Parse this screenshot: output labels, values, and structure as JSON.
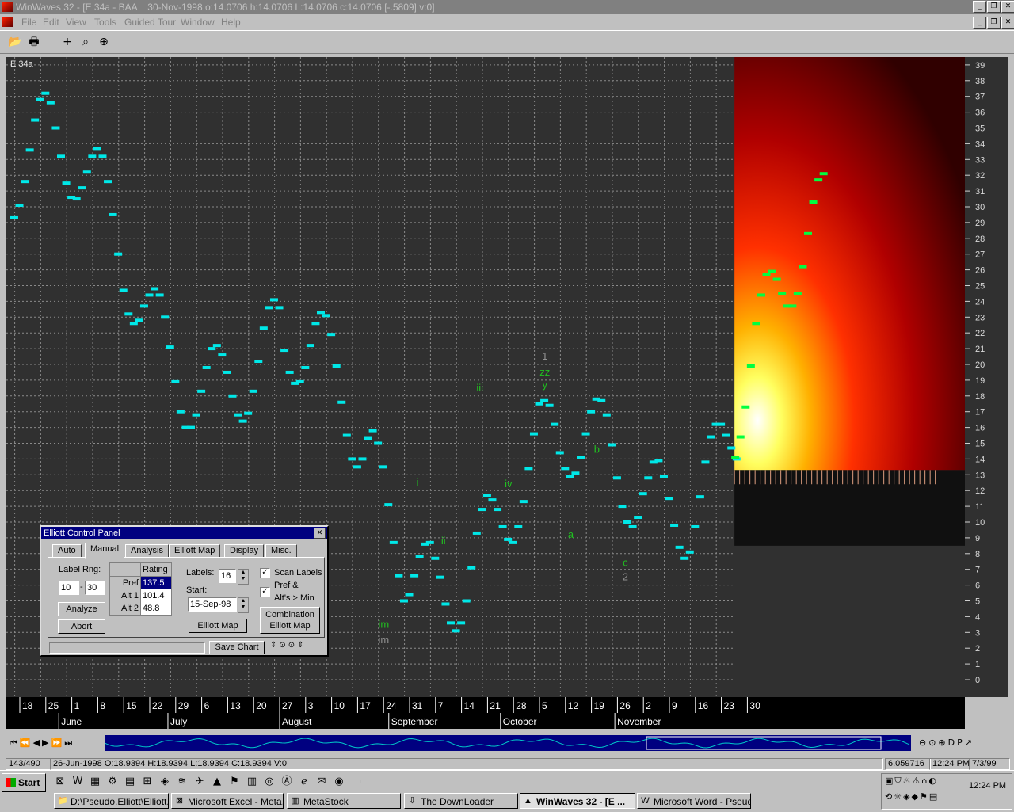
{
  "window": {
    "title": "WinWaves 32 - [E 34a - BAA    30-Nov-1998 o:14.0706 h:14.0706 L:14.0706 c:14.0706 [-.5809] v:0]"
  },
  "menu": [
    "File",
    "Edit",
    "View",
    "Tools",
    "Guided Tour",
    "Window",
    "Help"
  ],
  "toolbar_icons": [
    "open-icon",
    "print-icon",
    "crosshair-icon",
    "zoom-icon",
    "target-icon"
  ],
  "chart": {
    "symbol": "E 34a",
    "y_ticks": [
      "0",
      "1",
      "2",
      "3",
      "4",
      "5",
      "6",
      "7",
      "8",
      "9",
      "10",
      "11",
      "12",
      "13",
      "14",
      "15",
      "16",
      "17",
      "18",
      "19",
      "20",
      "21",
      "22",
      "23",
      "24",
      "25",
      "26",
      "27",
      "28",
      "29",
      "30",
      "31",
      "32",
      "33",
      "34",
      "35",
      "36",
      "37",
      "38",
      "39"
    ],
    "day_labels": [
      "18",
      "25",
      "1",
      "8",
      "15",
      "22",
      "29",
      "6",
      "13",
      "20",
      "27",
      "3",
      "10",
      "17",
      "24",
      "31",
      "7",
      "14",
      "21",
      "28",
      "5",
      "12",
      "19",
      "26",
      "2",
      "9",
      "16",
      "23",
      "30"
    ],
    "month_labels": [
      "June",
      "July",
      "August",
      "September",
      "October",
      "November"
    ],
    "wave_labels": [
      {
        "text": "1",
        "color": "#909090",
        "x": 19.9,
        "y": 20.3
      },
      {
        "text": "zz",
        "color": "#20c020",
        "x": 19.9,
        "y": 19.3
      },
      {
        "text": "y",
        "color": "#20c020",
        "x": 19.9,
        "y": 18.5
      },
      {
        "text": "iii",
        "color": "#20c020",
        "x": 17.4,
        "y": 18.3
      },
      {
        "text": "iv",
        "color": "#20c020",
        "x": 18.5,
        "y": 12.2
      },
      {
        "text": "i",
        "color": "#20c020",
        "x": 15.0,
        "y": 12.3
      },
      {
        "text": "ii",
        "color": "#20c020",
        "x": 16.0,
        "y": 8.6
      },
      {
        "text": "b",
        "color": "#20c020",
        "x": 21.9,
        "y": 14.4
      },
      {
        "text": "a",
        "color": "#20c020",
        "x": 20.9,
        "y": 9.0
      },
      {
        "text": "c",
        "color": "#20c020",
        "x": 23.0,
        "y": 7.2
      },
      {
        "text": "2",
        "color": "#909090",
        "x": 23.0,
        "y": 6.3
      },
      {
        "text": "im",
        "color": "#20c020",
        "x": 13.7,
        "y": 3.3
      },
      {
        "text": "im",
        "color": "#909090",
        "x": 13.7,
        "y": 2.3
      }
    ],
    "nav_icons": [
      "first-icon",
      "rewind-icon",
      "prev-icon",
      "next-icon",
      "fast-forward-icon",
      "last-icon"
    ],
    "right_icons": [
      "zoom-out-icon",
      "zoom-reset-icon",
      "zoom-in-icon",
      "d-icon",
      "p-icon",
      "trend-icon"
    ]
  },
  "chart_data": {
    "type": "scatter",
    "x_unit": "week index (0 = 18-Jun-1998)",
    "series": [
      {
        "name": "price",
        "values": [
          [
            -0.55,
            29.3
          ],
          [
            -0.35,
            30.1
          ],
          [
            -0.15,
            31.6
          ],
          [
            0.05,
            33.6
          ],
          [
            0.25,
            35.5
          ],
          [
            0.45,
            36.8
          ],
          [
            0.65,
            37.2
          ],
          [
            0.85,
            36.6
          ],
          [
            1.05,
            35.0
          ],
          [
            1.25,
            33.2
          ],
          [
            1.45,
            31.5
          ],
          [
            1.65,
            30.6
          ],
          [
            1.85,
            30.5
          ],
          [
            2.05,
            31.2
          ],
          [
            2.25,
            32.2
          ],
          [
            2.45,
            33.2
          ],
          [
            2.65,
            33.7
          ],
          [
            2.85,
            33.2
          ],
          [
            3.05,
            31.6
          ],
          [
            3.25,
            29.5
          ],
          [
            3.45,
            27.0
          ],
          [
            3.65,
            24.7
          ],
          [
            3.85,
            23.2
          ],
          [
            4.05,
            22.6
          ],
          [
            4.25,
            22.8
          ],
          [
            4.45,
            23.7
          ],
          [
            4.65,
            24.4
          ],
          [
            4.85,
            24.8
          ],
          [
            5.05,
            24.4
          ],
          [
            5.25,
            23.0
          ],
          [
            5.45,
            21.1
          ],
          [
            5.65,
            18.9
          ],
          [
            5.85,
            17.0
          ],
          [
            6.05,
            16.0
          ],
          [
            6.25,
            16.0
          ],
          [
            6.45,
            16.8
          ],
          [
            6.65,
            18.3
          ],
          [
            6.85,
            19.8
          ],
          [
            7.05,
            21.0
          ],
          [
            7.25,
            21.2
          ],
          [
            7.45,
            20.6
          ],
          [
            7.65,
            19.5
          ],
          [
            7.85,
            18.0
          ],
          [
            8.05,
            16.8
          ],
          [
            8.25,
            16.4
          ],
          [
            8.45,
            16.9
          ],
          [
            8.65,
            18.3
          ],
          [
            8.85,
            20.2
          ],
          [
            9.05,
            22.3
          ],
          [
            9.25,
            23.6
          ],
          [
            9.45,
            24.1
          ],
          [
            9.65,
            23.6
          ],
          [
            9.85,
            20.9
          ],
          [
            10.05,
            19.5
          ],
          [
            10.25,
            18.8
          ],
          [
            10.45,
            18.9
          ],
          [
            10.65,
            19.8
          ],
          [
            10.85,
            21.2
          ],
          [
            11.05,
            22.6
          ],
          [
            11.25,
            23.3
          ],
          [
            11.45,
            23.1
          ],
          [
            11.65,
            21.9
          ],
          [
            11.85,
            19.9
          ],
          [
            12.05,
            17.6
          ],
          [
            12.25,
            15.5
          ],
          [
            12.45,
            14.0
          ],
          [
            12.65,
            13.5
          ],
          [
            12.85,
            14.0
          ],
          [
            13.05,
            15.3
          ],
          [
            13.25,
            15.8
          ],
          [
            13.45,
            15.0
          ],
          [
            13.65,
            13.5
          ],
          [
            13.85,
            11.1
          ],
          [
            14.05,
            8.7
          ],
          [
            14.25,
            6.6
          ],
          [
            14.45,
            5.0
          ],
          [
            14.65,
            5.4
          ],
          [
            14.85,
            6.6
          ],
          [
            15.05,
            7.8
          ],
          [
            15.25,
            8.6
          ],
          [
            15.45,
            8.7
          ],
          [
            15.65,
            7.7
          ],
          [
            15.85,
            6.5
          ],
          [
            16.05,
            4.8
          ],
          [
            16.25,
            3.6
          ],
          [
            16.45,
            3.1
          ],
          [
            16.65,
            3.6
          ],
          [
            16.85,
            5.0
          ],
          [
            17.05,
            7.1
          ],
          [
            17.25,
            9.3
          ],
          [
            17.45,
            10.8
          ],
          [
            17.65,
            11.7
          ],
          [
            17.85,
            11.4
          ],
          [
            18.05,
            10.8
          ],
          [
            18.25,
            9.7
          ],
          [
            18.45,
            8.9
          ],
          [
            18.65,
            8.7
          ],
          [
            18.85,
            9.7
          ],
          [
            19.05,
            11.3
          ],
          [
            19.25,
            13.4
          ],
          [
            19.45,
            15.6
          ],
          [
            19.65,
            17.5
          ],
          [
            19.85,
            17.7
          ],
          [
            20.05,
            17.4
          ],
          [
            20.25,
            16.2
          ],
          [
            20.45,
            14.4
          ],
          [
            20.65,
            13.4
          ],
          [
            20.85,
            12.9
          ],
          [
            21.05,
            13.1
          ],
          [
            21.25,
            14.1
          ],
          [
            21.45,
            15.6
          ],
          [
            21.65,
            17.0
          ],
          [
            21.85,
            17.8
          ],
          [
            22.05,
            17.7
          ],
          [
            22.25,
            16.8
          ],
          [
            22.45,
            14.9
          ],
          [
            22.65,
            12.8
          ],
          [
            22.85,
            11.0
          ],
          [
            23.05,
            10.0
          ],
          [
            23.25,
            9.7
          ],
          [
            23.45,
            10.3
          ],
          [
            23.65,
            11.8
          ],
          [
            23.85,
            12.8
          ],
          [
            24.05,
            13.8
          ],
          [
            24.25,
            13.9
          ],
          [
            24.45,
            12.9
          ],
          [
            24.65,
            11.5
          ],
          [
            24.85,
            9.8
          ],
          [
            25.05,
            8.4
          ],
          [
            25.25,
            7.7
          ],
          [
            25.45,
            8.1
          ],
          [
            25.65,
            9.7
          ],
          [
            25.85,
            11.6
          ],
          [
            26.05,
            13.8
          ],
          [
            26.25,
            15.4
          ],
          [
            26.45,
            16.2
          ],
          [
            26.65,
            16.2
          ],
          [
            26.85,
            15.5
          ],
          [
            27.05,
            14.7
          ],
          [
            27.25,
            14.0
          ]
        ]
      },
      {
        "name": "projection",
        "values": [
          [
            27.2,
            14.1
          ],
          [
            27.4,
            15.4
          ],
          [
            27.6,
            17.3
          ],
          [
            27.8,
            19.9
          ],
          [
            28.0,
            22.6
          ],
          [
            28.2,
            24.4
          ],
          [
            28.4,
            25.7
          ],
          [
            28.6,
            25.9
          ],
          [
            28.8,
            25.4
          ],
          [
            29.0,
            24.5
          ],
          [
            29.2,
            23.7
          ],
          [
            29.4,
            23.7
          ],
          [
            29.6,
            24.5
          ],
          [
            29.8,
            26.2
          ],
          [
            30.0,
            28.3
          ],
          [
            30.2,
            30.3
          ],
          [
            30.4,
            31.7
          ],
          [
            30.6,
            32.1
          ]
        ]
      }
    ],
    "ylim": [
      -1,
      39.6
    ],
    "xlim": [
      -0.6,
      34.4
    ]
  },
  "panel": {
    "title": "Elliott Control Panel",
    "tabs": [
      "Auto",
      "Manual",
      "Analysis",
      "Elliott Map",
      "Display",
      "Misc."
    ],
    "label_rng": "Label Rng:",
    "rng_from": "10",
    "rng_dash": "-",
    "rng_to": "30",
    "rating_header": "Rating",
    "rows": [
      {
        "name": "Pref",
        "value": "137.5"
      },
      {
        "name": "Alt 1",
        "value": "101.4"
      },
      {
        "name": "Alt 2",
        "value": "48.8"
      }
    ],
    "labels_label": "Labels:",
    "labels_value": "16",
    "start_label": "Start:",
    "start_value": "15-Sep-98",
    "scan_labels": "Scan Labels",
    "pref_alts_1": "Pref &",
    "pref_alts_2": "Alt's > Min",
    "analyze": "Analyze",
    "abort": "Abort",
    "elliott_map": "Elliott Map",
    "combo_1": "Combination",
    "combo_2": "Elliott Map",
    "save_chart": "Save Chart"
  },
  "status": [
    "143/490",
    "26-Jun-1998  O:18.9394 H:18.9394 L:18.9394 C:18.9394 V:0",
    "6.059716",
    "12:24 PM",
    "7/3/99"
  ],
  "taskbar": {
    "start": "Start",
    "tasks": [
      "D:\\Pseudo.Elliott\\Elliott...",
      "Microsoft Excel - Meta...",
      "MetaStock",
      "The DownLoader",
      "WinWaves 32 - [E ...",
      "Microsoft Word - Pseud..."
    ],
    "clock": "12:24 PM"
  },
  "colors": {
    "bars": "#00e8e8",
    "chart_bg": "#303030",
    "grid": "#8a8a8a",
    "label_green": "#20c020",
    "label_gray": "#909090"
  }
}
